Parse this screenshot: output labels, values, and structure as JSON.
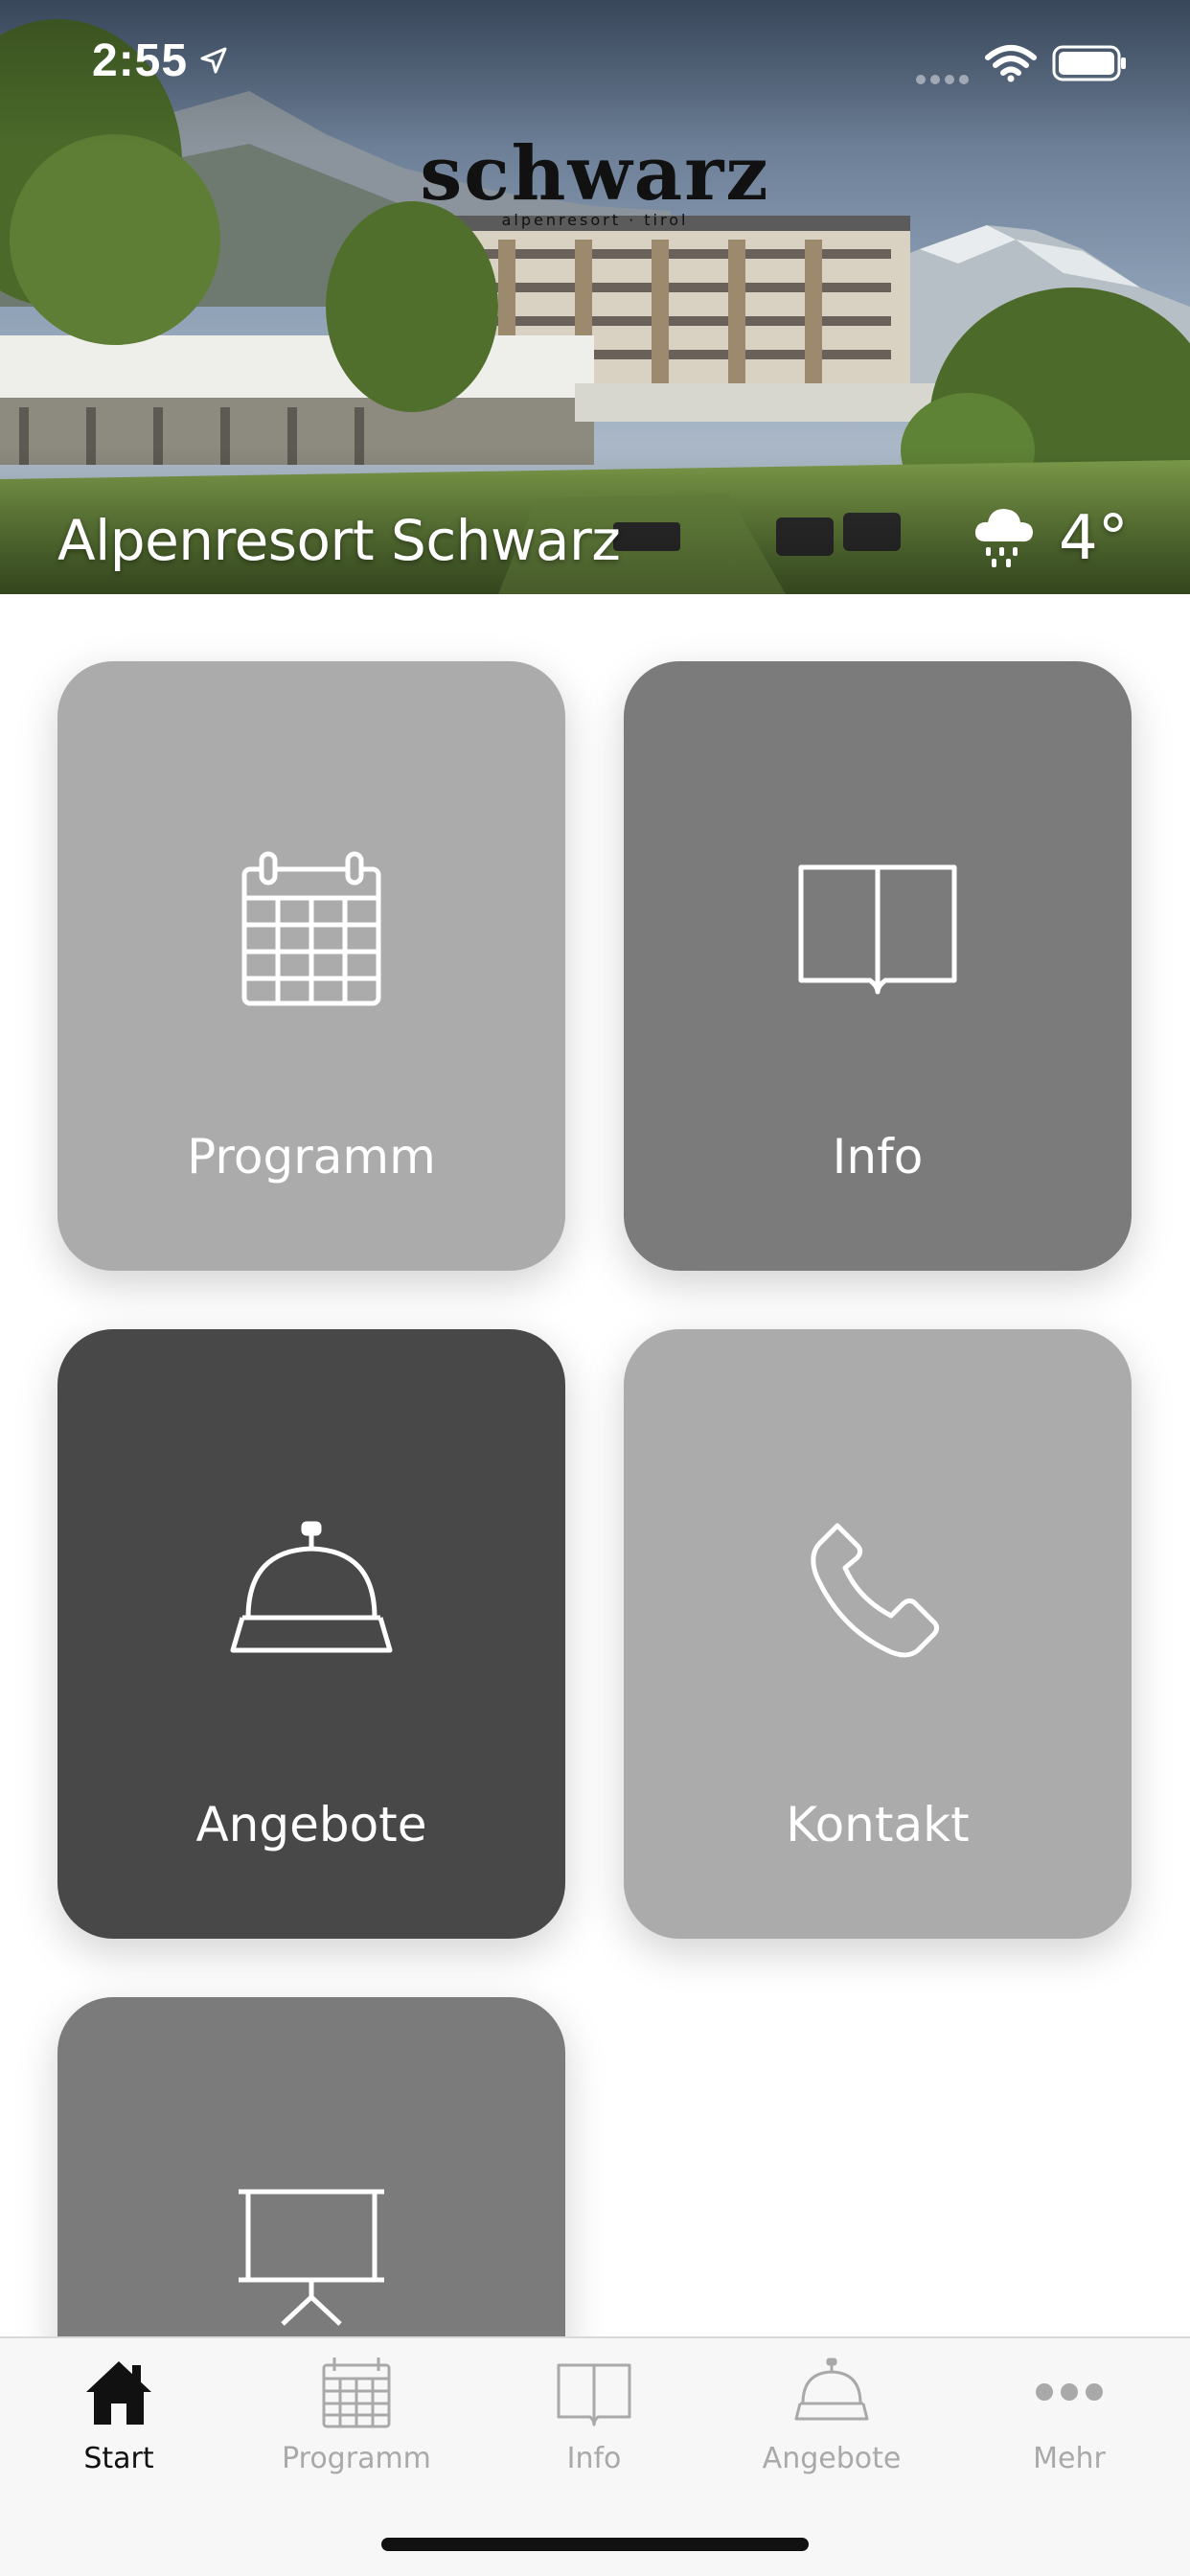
{
  "status_bar": {
    "time": "2:55"
  },
  "header": {
    "logo_text": "schwarz",
    "logo_subtext": "alpenresort · tirol",
    "title": "Alpenresort Schwarz",
    "weather_icon": "rain-cloud-icon",
    "temperature": "4°"
  },
  "tiles": [
    {
      "label": "Programm",
      "icon": "calendar-icon",
      "color": "#ababab"
    },
    {
      "label": "Info",
      "icon": "book-icon",
      "color": "#7b7b7b"
    },
    {
      "label": "Angebote",
      "icon": "service-bell-icon",
      "color": "#484848"
    },
    {
      "label": "Kontakt",
      "icon": "phone-icon",
      "color": "#ababab"
    },
    {
      "label": "",
      "icon": "presentation-board-icon",
      "color": "#7b7b7b"
    }
  ],
  "tabbar": {
    "items": [
      {
        "label": "Start",
        "icon": "home-icon",
        "active": true
      },
      {
        "label": "Programm",
        "icon": "calendar-icon",
        "active": false
      },
      {
        "label": "Info",
        "icon": "book-icon",
        "active": false
      },
      {
        "label": "Angebote",
        "icon": "service-bell-icon",
        "active": false
      },
      {
        "label": "Mehr",
        "icon": "more-dots-icon",
        "active": false
      }
    ],
    "active_color": "#111111",
    "inactive_color": "#a9a9a9"
  }
}
